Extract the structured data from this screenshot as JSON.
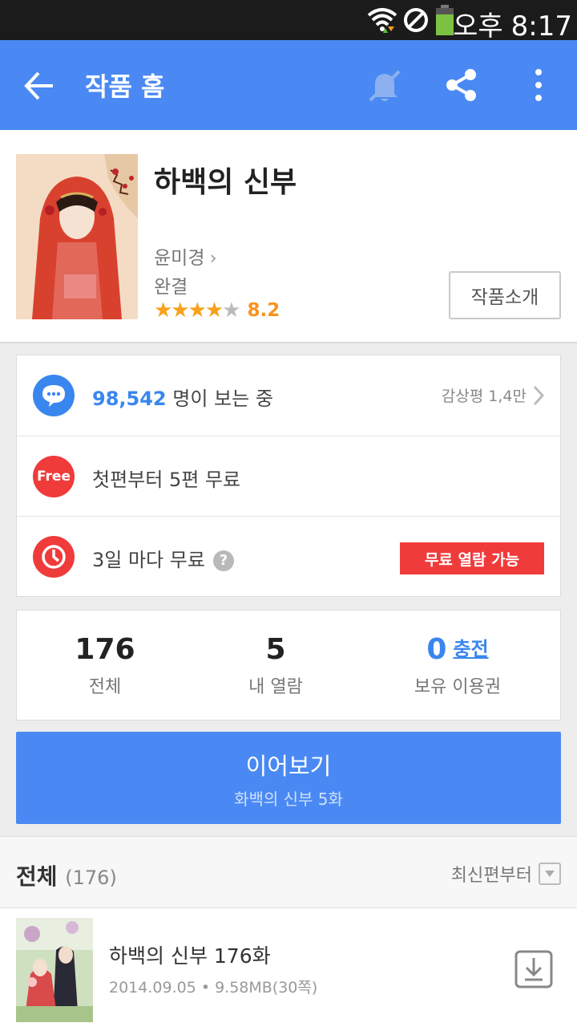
{
  "status_bar": {
    "ampm": "오후",
    "time": "8:17"
  },
  "appbar": {
    "title": "작품 홈"
  },
  "work": {
    "title": "하백의 신부",
    "author": "윤미경",
    "status": "완결",
    "rating": 8.2,
    "rating_label": "8.2",
    "stars": "★★★★",
    "star_off": "★",
    "intro_label": "작품소개"
  },
  "info": {
    "viewers_count": "98,542",
    "viewers_suffix": " 명이 보는 중",
    "review_label": "감상평 1,4만",
    "free_icon_label": "Free",
    "free_text": "첫편부터 5편 무료",
    "wait_text": "3일 마다 무료",
    "help_symbol": "?",
    "free_badge": "무료 열람 가능"
  },
  "stats": {
    "total_num": "176",
    "total_label": "전체",
    "read_num": "5",
    "read_label": "내 열람",
    "ticket_num": "0",
    "charge_label": "충전",
    "ticket_label": "보유 이용권"
  },
  "continue_btn": {
    "label": "이어보기",
    "sub": "화백의 신부 5화"
  },
  "list": {
    "title": "전체",
    "count": "(176)",
    "sort_label": "최신편부터"
  },
  "episodes": [
    {
      "title": "하백의 신부 176화",
      "meta": "2014.09.05 • 9.58MB(30쪽)"
    }
  ],
  "colors": {
    "primary": "#4a89f3",
    "accent_blue": "#3a86ef",
    "red": "#f03b3b",
    "star": "#f7a21b"
  }
}
